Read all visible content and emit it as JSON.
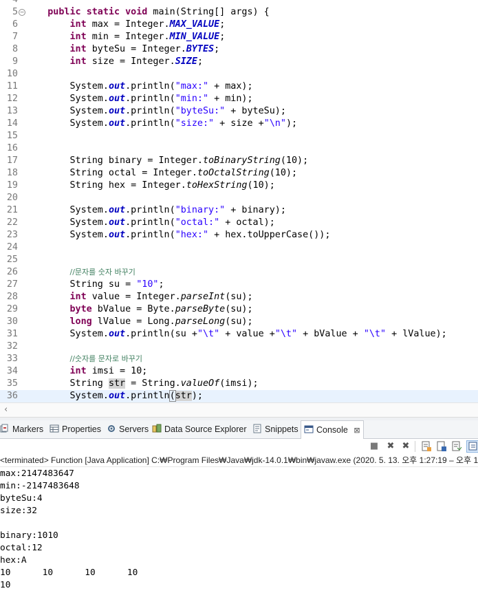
{
  "editor": {
    "lines": [
      {
        "num": "4",
        "fold": false,
        "tokens": []
      },
      {
        "num": "5",
        "fold": true,
        "tokens": [
          {
            "t": "    "
          },
          {
            "t": "public",
            "c": "kw"
          },
          {
            "t": " "
          },
          {
            "t": "static",
            "c": "kw"
          },
          {
            "t": " "
          },
          {
            "t": "void",
            "c": "kw"
          },
          {
            "t": " main(String[] args) {"
          }
        ]
      },
      {
        "num": "6",
        "tokens": [
          {
            "t": "        "
          },
          {
            "t": "int",
            "c": "kw"
          },
          {
            "t": " max = Integer."
          },
          {
            "t": "MAX_VALUE",
            "c": "sti"
          },
          {
            "t": ";"
          }
        ]
      },
      {
        "num": "7",
        "tokens": [
          {
            "t": "        "
          },
          {
            "t": "int",
            "c": "kw"
          },
          {
            "t": " min = Integer."
          },
          {
            "t": "MIN_VALUE",
            "c": "sti"
          },
          {
            "t": ";"
          }
        ]
      },
      {
        "num": "8",
        "tokens": [
          {
            "t": "        "
          },
          {
            "t": "int",
            "c": "kw"
          },
          {
            "t": " byteSu = Integer."
          },
          {
            "t": "BYTES",
            "c": "sti"
          },
          {
            "t": ";"
          }
        ]
      },
      {
        "num": "9",
        "tokens": [
          {
            "t": "        "
          },
          {
            "t": "int",
            "c": "kw"
          },
          {
            "t": " size = Integer."
          },
          {
            "t": "SIZE",
            "c": "sti"
          },
          {
            "t": ";"
          }
        ]
      },
      {
        "num": "10",
        "tokens": []
      },
      {
        "num": "11",
        "tokens": [
          {
            "t": "        System."
          },
          {
            "t": "out",
            "c": "sti"
          },
          {
            "t": ".println("
          },
          {
            "t": "\"max:\"",
            "c": "st"
          },
          {
            "t": " + max);"
          }
        ]
      },
      {
        "num": "12",
        "tokens": [
          {
            "t": "        System."
          },
          {
            "t": "out",
            "c": "sti"
          },
          {
            "t": ".println("
          },
          {
            "t": "\"min:\"",
            "c": "st"
          },
          {
            "t": " + min);"
          }
        ]
      },
      {
        "num": "13",
        "tokens": [
          {
            "t": "        System."
          },
          {
            "t": "out",
            "c": "sti"
          },
          {
            "t": ".println("
          },
          {
            "t": "\"byteSu:\"",
            "c": "st"
          },
          {
            "t": " + byteSu);"
          }
        ]
      },
      {
        "num": "14",
        "tokens": [
          {
            "t": "        System."
          },
          {
            "t": "out",
            "c": "sti"
          },
          {
            "t": ".println("
          },
          {
            "t": "\"size:\"",
            "c": "st"
          },
          {
            "t": " + size +"
          },
          {
            "t": "\"\\n\"",
            "c": "st"
          },
          {
            "t": ");"
          }
        ]
      },
      {
        "num": "15",
        "tokens": []
      },
      {
        "num": "16",
        "tokens": []
      },
      {
        "num": "17",
        "tokens": [
          {
            "t": "        String binary = Integer."
          },
          {
            "t": "toBinaryString",
            "c": "mi"
          },
          {
            "t": "(10);"
          }
        ]
      },
      {
        "num": "18",
        "tokens": [
          {
            "t": "        String octal = Integer."
          },
          {
            "t": "toOctalString",
            "c": "mi"
          },
          {
            "t": "(10);"
          }
        ]
      },
      {
        "num": "19",
        "tokens": [
          {
            "t": "        String hex = Integer."
          },
          {
            "t": "toHexString",
            "c": "mi"
          },
          {
            "t": "(10);"
          }
        ]
      },
      {
        "num": "20",
        "tokens": []
      },
      {
        "num": "21",
        "tokens": [
          {
            "t": "        System."
          },
          {
            "t": "out",
            "c": "sti"
          },
          {
            "t": ".println("
          },
          {
            "t": "\"binary:\"",
            "c": "st"
          },
          {
            "t": " + binary);"
          }
        ]
      },
      {
        "num": "22",
        "tokens": [
          {
            "t": "        System."
          },
          {
            "t": "out",
            "c": "sti"
          },
          {
            "t": ".println("
          },
          {
            "t": "\"octal:\"",
            "c": "st"
          },
          {
            "t": " + octal);"
          }
        ]
      },
      {
        "num": "23",
        "tokens": [
          {
            "t": "        System."
          },
          {
            "t": "out",
            "c": "sti"
          },
          {
            "t": ".println("
          },
          {
            "t": "\"hex:\"",
            "c": "st"
          },
          {
            "t": " + hex.toUpperCase());"
          }
        ]
      },
      {
        "num": "24",
        "tokens": []
      },
      {
        "num": "25",
        "tokens": []
      },
      {
        "num": "26",
        "tokens": [
          {
            "t": "        "
          },
          {
            "t": "//문자를 숫자 바꾸기",
            "c": "cm"
          }
        ]
      },
      {
        "num": "27",
        "tokens": [
          {
            "t": "        String su = "
          },
          {
            "t": "\"10\"",
            "c": "st"
          },
          {
            "t": ";"
          }
        ]
      },
      {
        "num": "28",
        "tokens": [
          {
            "t": "        "
          },
          {
            "t": "int",
            "c": "kw"
          },
          {
            "t": " value = Integer."
          },
          {
            "t": "parseInt",
            "c": "mi"
          },
          {
            "t": "(su);"
          }
        ]
      },
      {
        "num": "29",
        "tokens": [
          {
            "t": "        "
          },
          {
            "t": "byte",
            "c": "kw"
          },
          {
            "t": " bValue = Byte."
          },
          {
            "t": "parseByte",
            "c": "mi"
          },
          {
            "t": "(su);"
          }
        ]
      },
      {
        "num": "30",
        "tokens": [
          {
            "t": "        "
          },
          {
            "t": "long",
            "c": "kw"
          },
          {
            "t": " lValue = Long."
          },
          {
            "t": "parseLong",
            "c": "mi"
          },
          {
            "t": "(su);"
          }
        ]
      },
      {
        "num": "31",
        "tokens": [
          {
            "t": "        System."
          },
          {
            "t": "out",
            "c": "sti"
          },
          {
            "t": ".println(su +"
          },
          {
            "t": "\"\\t\"",
            "c": "st"
          },
          {
            "t": " + value +"
          },
          {
            "t": "\"\\t\"",
            "c": "st"
          },
          {
            "t": " + bValue + "
          },
          {
            "t": "\"\\t\"",
            "c": "st"
          },
          {
            "t": " + lValue);"
          }
        ]
      },
      {
        "num": "32",
        "tokens": []
      },
      {
        "num": "33",
        "tokens": [
          {
            "t": "        "
          },
          {
            "t": "//숫자를 문자로 바꾸기",
            "c": "cm"
          }
        ]
      },
      {
        "num": "34",
        "tokens": [
          {
            "t": "        "
          },
          {
            "t": "int",
            "c": "kw"
          },
          {
            "t": " imsi = 10;"
          }
        ]
      },
      {
        "num": "35",
        "tokens": [
          {
            "t": "        String "
          },
          {
            "t": "str",
            "c": "occ"
          },
          {
            "t": " = String."
          },
          {
            "t": "valueOf",
            "c": "mi"
          },
          {
            "t": "(imsi);"
          }
        ]
      },
      {
        "num": "36",
        "active": true,
        "tokens": [
          {
            "t": "        System."
          },
          {
            "t": "out",
            "c": "sti"
          },
          {
            "t": ".println"
          },
          {
            "t": "(",
            "c": "bracket"
          },
          {
            "t": "str",
            "c": "occ"
          },
          {
            "t": ");"
          }
        ]
      }
    ]
  },
  "tabs": [
    {
      "label": "Markers",
      "icon": "markers-icon"
    },
    {
      "label": "Properties",
      "icon": "properties-icon"
    },
    {
      "label": "Servers",
      "icon": "servers-icon"
    },
    {
      "label": "Data Source Explorer",
      "icon": "data-source-icon"
    },
    {
      "label": "Snippets",
      "icon": "snippets-icon"
    },
    {
      "label": "Console",
      "icon": "console-icon",
      "active": true,
      "close": "⊠"
    }
  ],
  "console": {
    "status": "<terminated> Function [Java Application] C:₩Program Files₩Java₩jdk-14.0.1₩bin₩javaw.exe  (2020. 5. 13. 오후 1:27:19 – 오후 1",
    "output": [
      "max:2147483647",
      "min:-2147483648",
      "byteSu:4",
      "size:32",
      "",
      "binary:1010",
      "octal:12",
      "hex:A",
      "10      10      10      10",
      "10"
    ]
  },
  "colors": {
    "keyword": "#7f0055",
    "string": "#2a00ff",
    "static_field": "#0000c0",
    "comment": "#3f7f5f",
    "active_line": "#e8f2fe"
  }
}
